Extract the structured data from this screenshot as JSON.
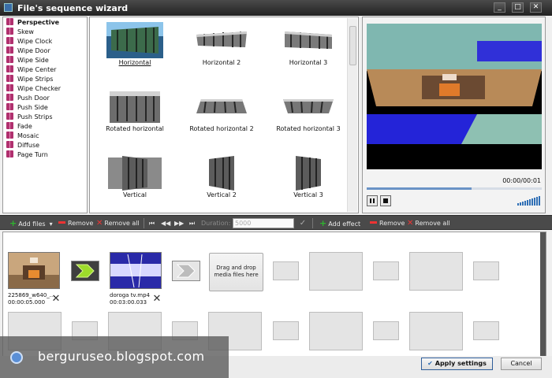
{
  "window": {
    "title": "File's sequence wizard",
    "buttons": [
      "_",
      "□",
      "✕"
    ]
  },
  "effects": {
    "items": [
      "Perspective",
      "Skew",
      "Wipe Clock",
      "Wipe Door",
      "Wipe Side",
      "Wipe Center",
      "Wipe Strips",
      "Wipe Checker",
      "Push Door",
      "Push Side",
      "Push Strips",
      "Fade",
      "Mosaic",
      "Diffuse",
      "Page Turn"
    ],
    "selected": "Perspective"
  },
  "thumbnails": [
    {
      "label": "Horizontal",
      "selected": true
    },
    {
      "label": "Horizontal 2"
    },
    {
      "label": "Horizontal 3"
    },
    {
      "label": "Rotated horizontal"
    },
    {
      "label": "Rotated horizontal 2"
    },
    {
      "label": "Rotated horizontal 3"
    },
    {
      "label": "Vertical"
    },
    {
      "label": "Vertical 2"
    },
    {
      "label": "Vertical 3"
    }
  ],
  "preview": {
    "time": "00:00/00:01",
    "progress": 0.6
  },
  "toolbar": {
    "add_files": "Add files",
    "remove": "Remove",
    "remove_all": "Remove all",
    "duration_label": "Duration:",
    "duration_value": "5000",
    "add_effect": "Add effect",
    "remove_effect": "Remove",
    "remove_all_effects": "Remove all",
    "nav_first": "⏮",
    "nav_prev": "◀◀",
    "nav_next": "▶▶",
    "nav_last": "⏭"
  },
  "timeline": {
    "clips": [
      {
        "name": "225869_w640_...",
        "duration": "00:00:05.000"
      },
      {
        "name": "doroga tv.mp4",
        "duration": "00:03:00.033"
      }
    ],
    "dropzone": "Drag and drop media files here"
  },
  "footer": {
    "apply": "Apply settings",
    "cancel": "Cancel"
  },
  "watermark": {
    "text": "berguruseo.blogspot.com"
  }
}
